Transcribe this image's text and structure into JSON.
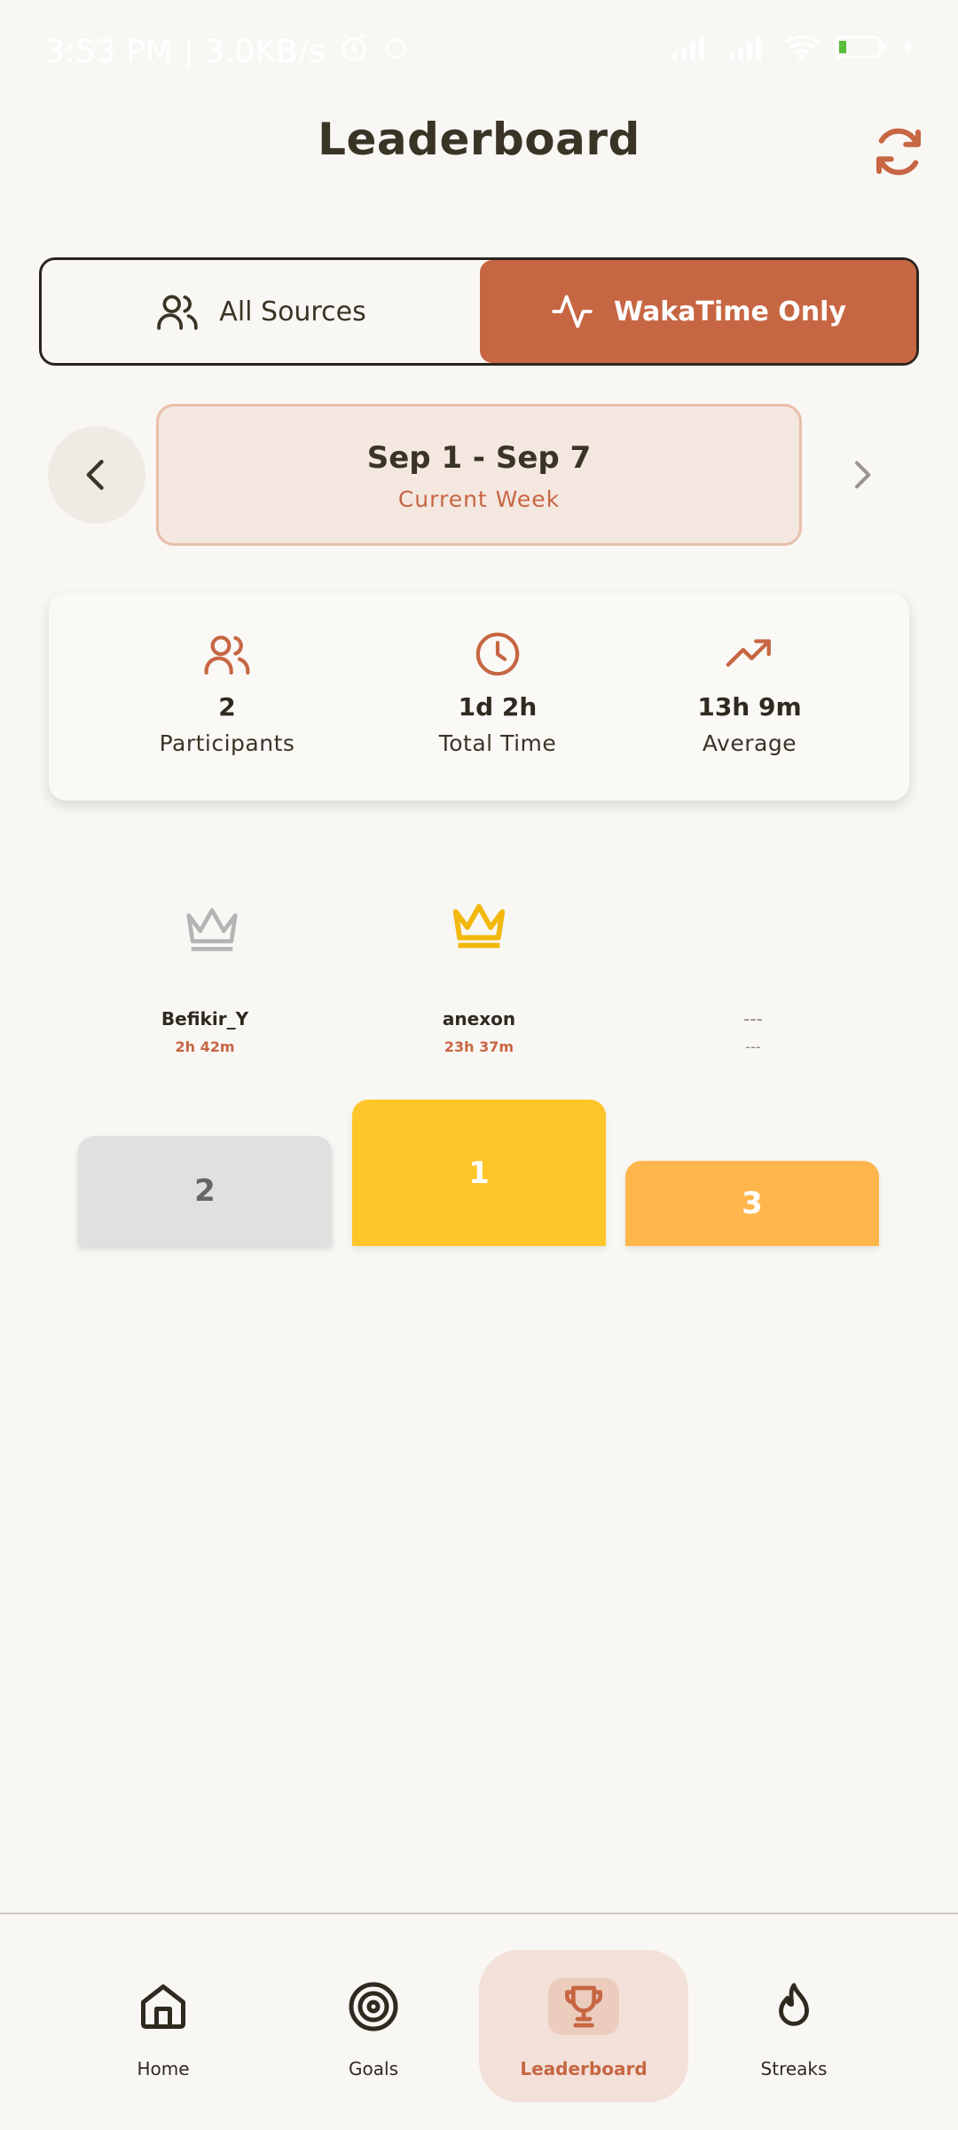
{
  "status_bar": {
    "time_speed": "3:53 PM | 3.0KB/s",
    "battery_level": 0.2
  },
  "header": {
    "title": "Leaderboard",
    "refresh_icon": "refresh-icon"
  },
  "source_toggle": {
    "all_label": "All Sources",
    "waka_label": "WakaTime Only",
    "selected": "WakaTime Only"
  },
  "week_nav": {
    "range": "Sep 1 - Sep 7",
    "label": "Current Week"
  },
  "stats": {
    "participants_value": "2",
    "participants_label": "Participants",
    "total_value": "1d 2h",
    "total_label": "Total Time",
    "average_value": "13h 9m",
    "average_label": "Average"
  },
  "podium": {
    "second": {
      "name": "Befikir_Y",
      "time": "2h 42m",
      "rank": "2"
    },
    "first": {
      "name": "anexon",
      "time": "23h 37m",
      "rank": "1"
    },
    "third": {
      "name": "---",
      "time": "---",
      "rank": "3"
    }
  },
  "bottom_nav": {
    "home": "Home",
    "goals": "Goals",
    "leaderboard": "Leaderboard",
    "streaks": "Streaks",
    "active": "Leaderboard"
  },
  "colors": {
    "accent": "#c76643",
    "gold": "#ffc629",
    "silver": "#e0e0e0",
    "bronze": "#ffb74d",
    "background": "#f9f7f4"
  }
}
